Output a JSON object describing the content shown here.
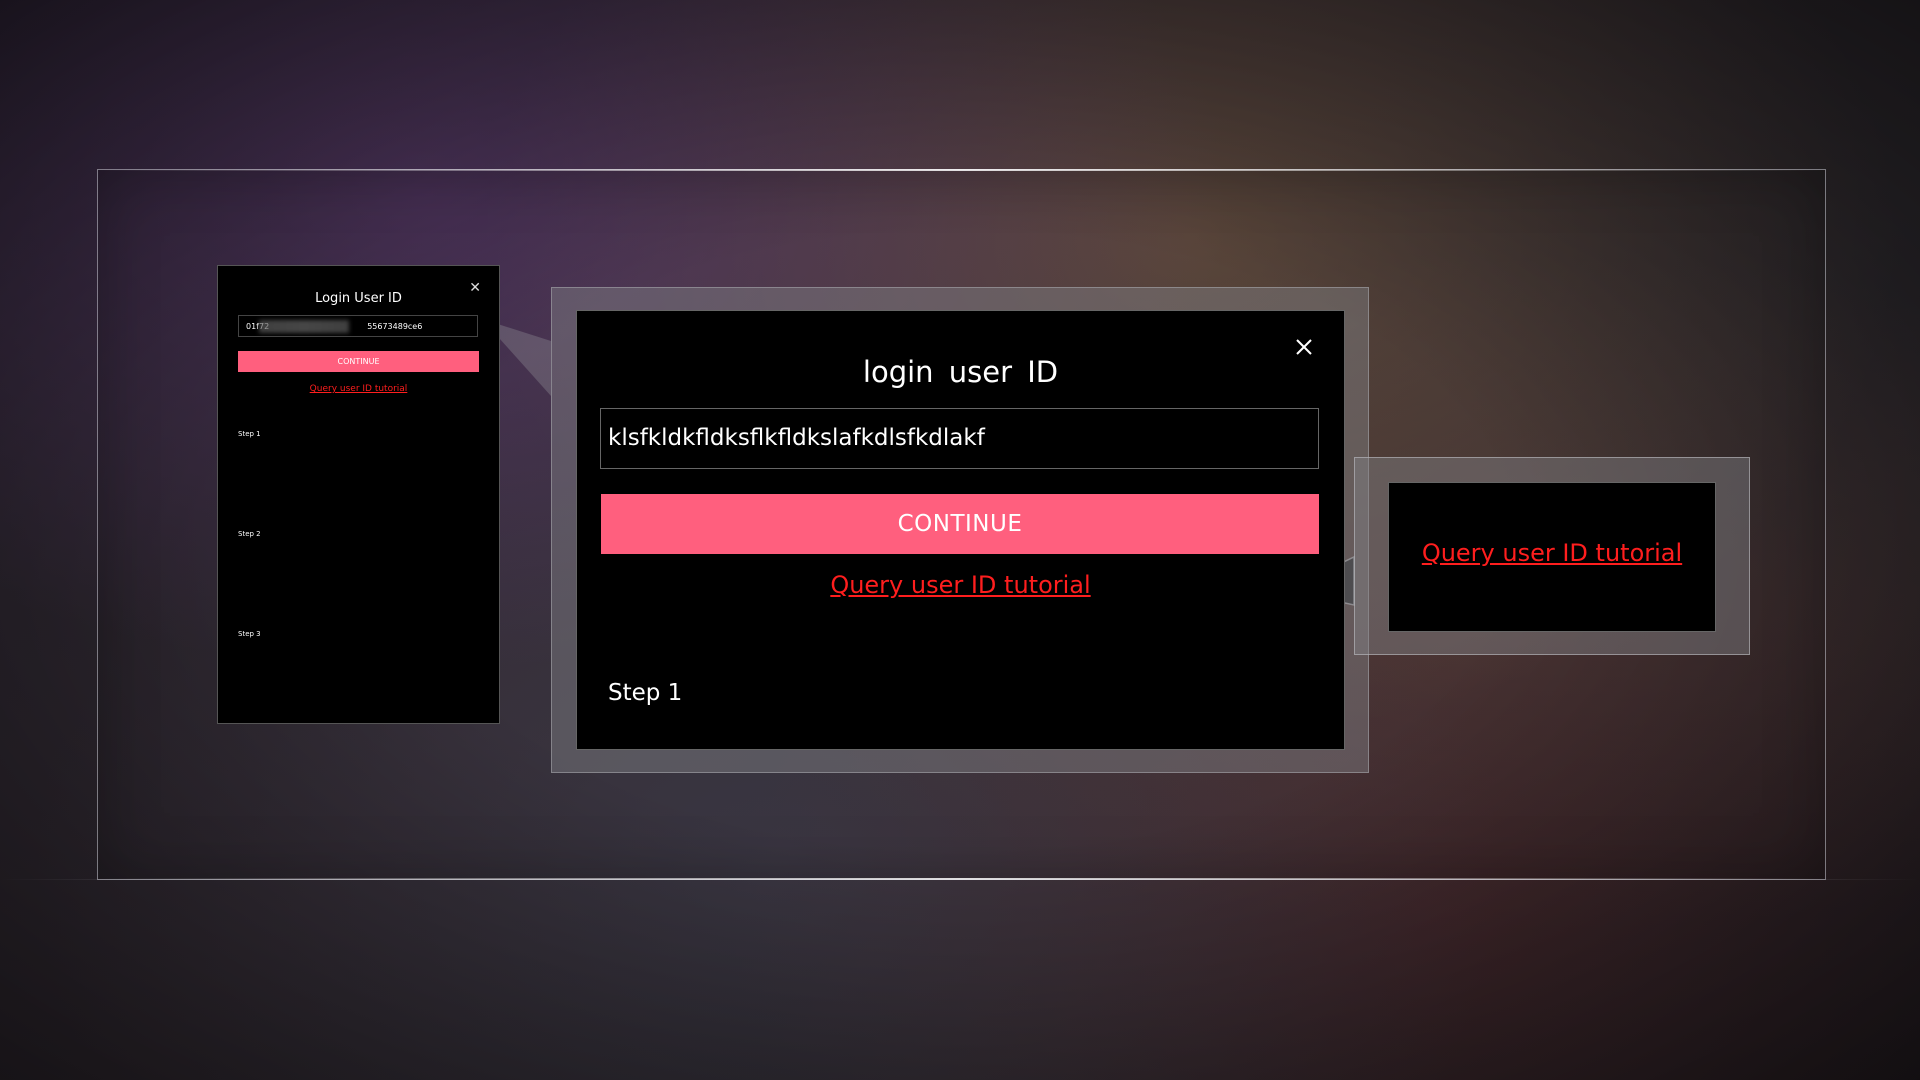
{
  "colors": {
    "accent": "#ff5f7e",
    "link": "#ff1e1e",
    "dialog_bg": "#000000",
    "text": "#ffffff"
  },
  "small_dialog": {
    "title": "Login User ID",
    "input_value": "01f72",
    "input_value_suffix": "55673489ce6",
    "continue_label": "CONTINUE",
    "tutorial_link": "Query user ID tutorial",
    "steps": [
      "Step 1",
      "Step 2",
      "Step 3"
    ]
  },
  "big_dialog": {
    "title": "login  user  ID",
    "input_value": "klsfkldkfldksflkfldkslafkdlsfkdlakf",
    "continue_label": "CONTINUE",
    "tutorial_link": "Query user ID tutorial",
    "step_label": "Step 1"
  },
  "callout": {
    "tutorial_link": "Query user ID tutorial"
  },
  "icons": {
    "close": "close-icon"
  }
}
